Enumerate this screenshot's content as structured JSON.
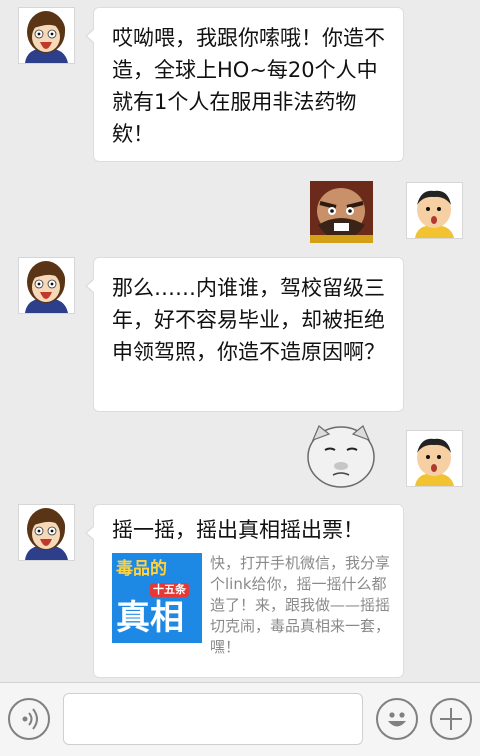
{
  "messages": [
    {
      "text": "哎呦喂，我跟你嗦哦！你造不造，全球上HO~每20个人中就有1个人在服用非法药物欸！"
    },
    {
      "sticker": "angry-monk-sticker"
    },
    {
      "text": "那么……内谁谁，驾校留级三年，好不容易毕业，却被拒绝申领驾照，你造不造原因啊？"
    },
    {
      "sticker": "fat-cat-face-sticker"
    },
    {
      "card_title": "摇一摇，摇出真相摇出票！",
      "card_description": "快，打开手机微信，我分享个link给你，摇一摇什么都造了！来，跟我做——摇摇切克闹，毒品真相来一套，嘿！",
      "thumb": {
        "top": "毒品的",
        "badge": "十五条",
        "main": "真相"
      }
    }
  ],
  "toolbar": {
    "voice_icon": "voice-icon",
    "emoji_icon": "smiley-icon",
    "plus_icon": "plus-icon",
    "input_value": ""
  },
  "colors": {
    "background": "#ebebeb",
    "bubble": "#ffffff",
    "thumb_blue": "#1e88e5"
  }
}
